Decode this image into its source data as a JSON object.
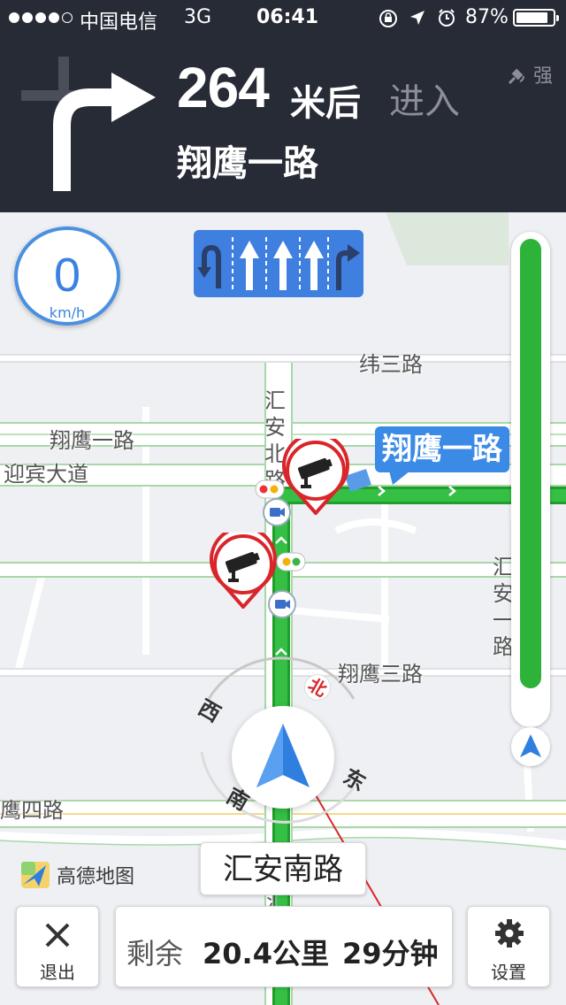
{
  "status_bar": {
    "carrier": "中国电信",
    "network": "3G",
    "time": "06:41",
    "battery": "87%",
    "battery_level": 0.87,
    "signal_dots_filled": 4,
    "signal_dots_total": 5,
    "icons": [
      "rotation-lock-icon",
      "location-arrow-icon",
      "alarm-icon",
      "battery-icon"
    ]
  },
  "navigation": {
    "maneuver_icon": "turn-right-arrow-icon",
    "distance_value": "264",
    "distance_unit": "米后",
    "action": "进入",
    "next_road": "翔鹰一路",
    "gps_signal": "强"
  },
  "speedometer": {
    "value": "0",
    "unit": "km/h"
  },
  "lane_guidance": {
    "lanes": [
      "u-turn-left",
      "straight",
      "straight",
      "straight",
      "right"
    ]
  },
  "map": {
    "road_labels": {
      "weisan": "纬三路",
      "xiangying1": "翔鹰一路",
      "yingbin": "迎宾大道",
      "huianbei": "汇安北路",
      "xiangying3": "翔鹰三路",
      "xiangying4_partial": "鹰四路",
      "huian_right": "汇安一路",
      "huian_bottom": "汇安"
    },
    "next_road_callout": "翔鹰一路",
    "compass": {
      "north": "北",
      "south": "南",
      "east": "东",
      "west": "西"
    },
    "current_road": "汇安南路",
    "logo_text": "高德地图"
  },
  "route_progress": {
    "remaining_fraction": 1.0
  },
  "bottom_bar": {
    "exit_label": "退出",
    "remaining_label": "剩余",
    "remaining_distance": "20.4公里",
    "remaining_time": "29分钟",
    "settings_label": "设置"
  },
  "colors": {
    "header_bg": "#272b36",
    "route_green": "#2db33a",
    "accent_blue": "#3b8ae6",
    "camera_red": "#d9262b"
  }
}
